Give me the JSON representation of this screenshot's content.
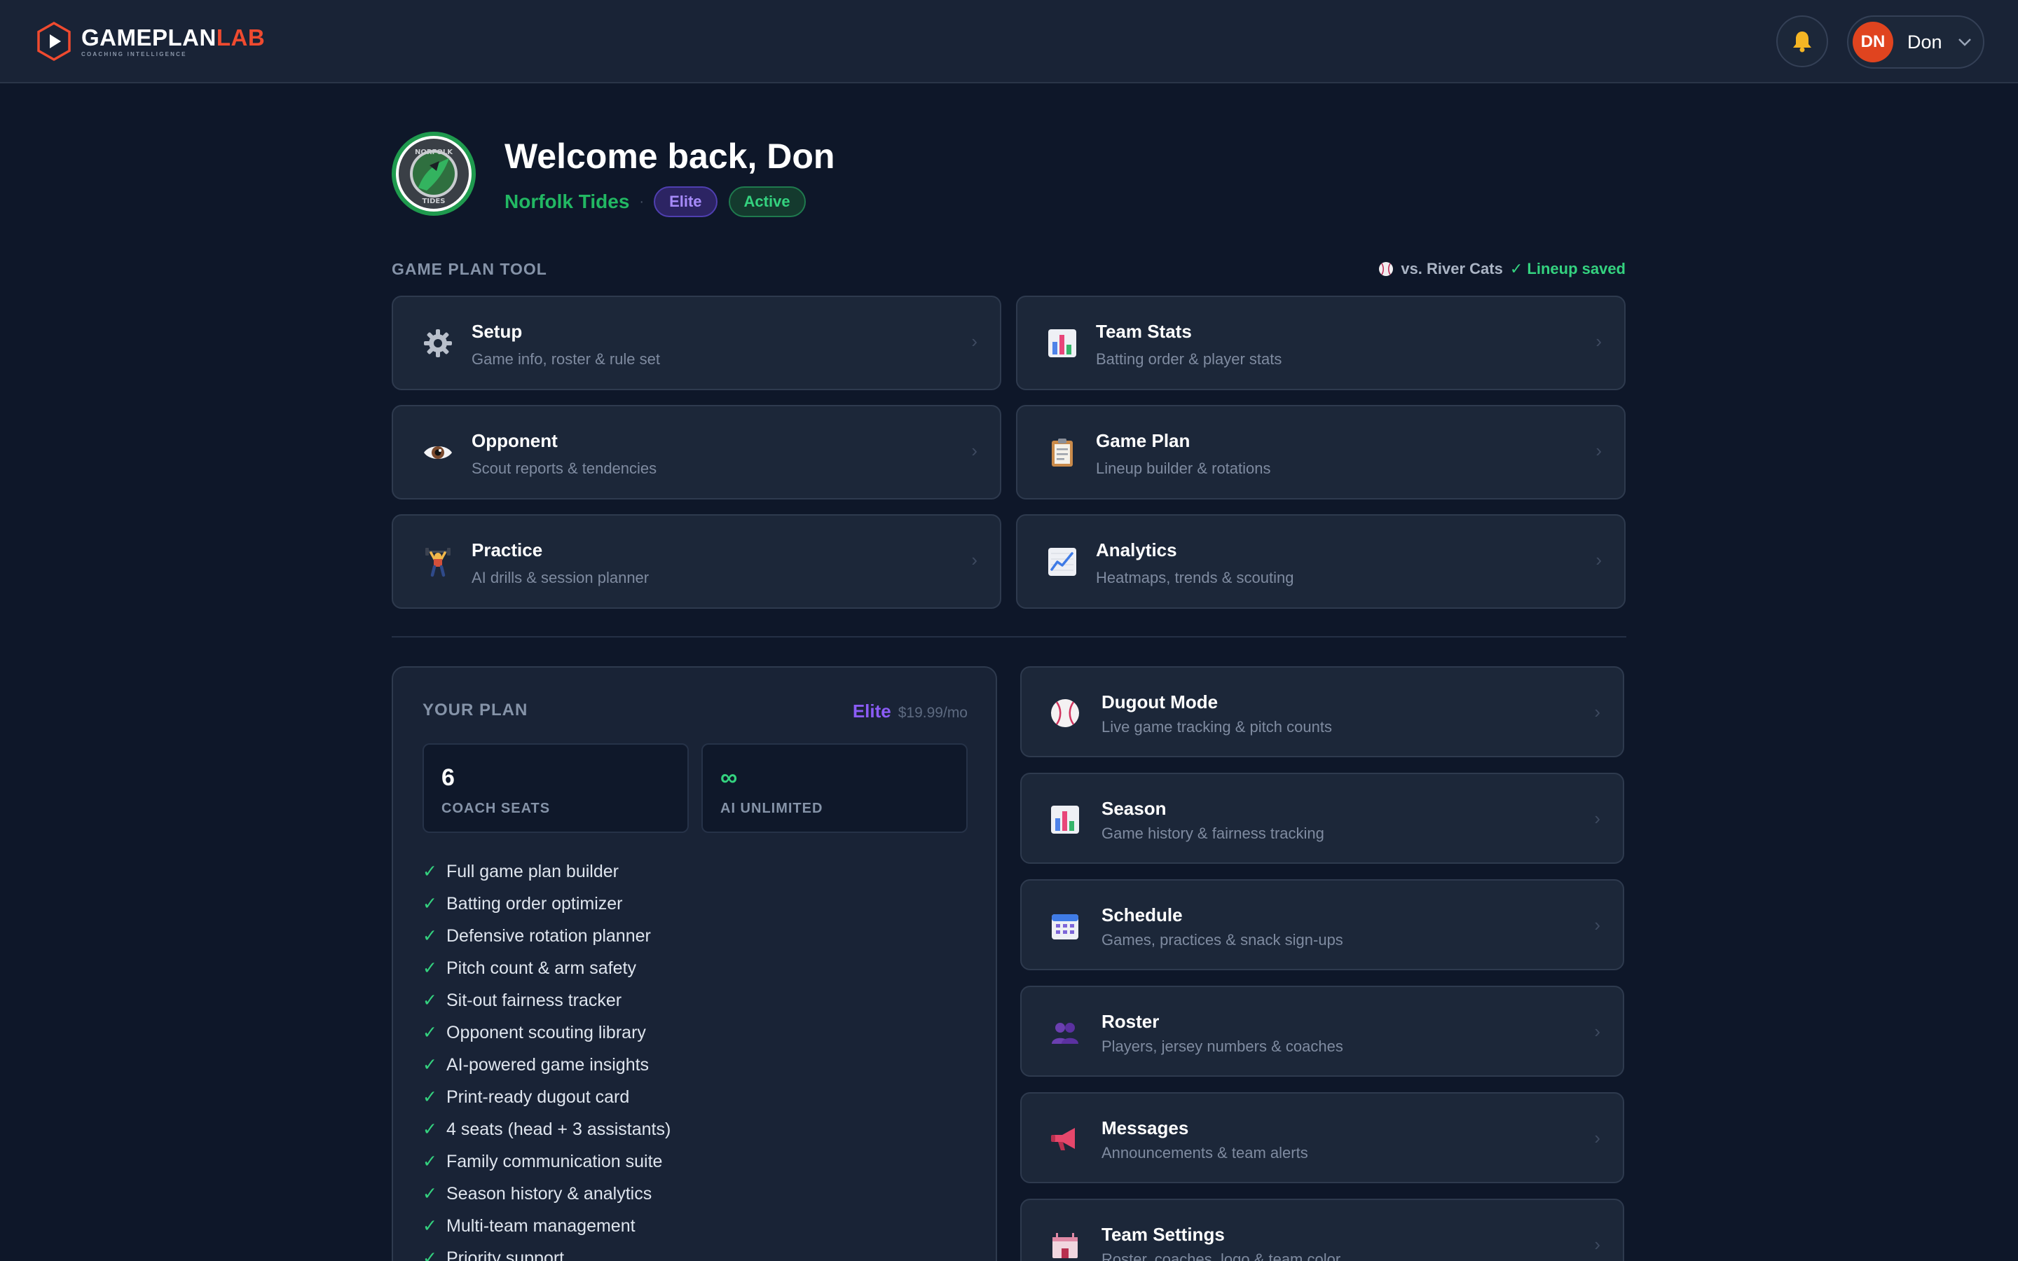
{
  "brand": {
    "name_part1": "GAMEPLAN",
    "name_part2": "LAB",
    "tagline": "COACHING INTELLIGENCE"
  },
  "user": {
    "initials": "DN",
    "name": "Don"
  },
  "header": {
    "welcome": "Welcome back, Don",
    "team_name": "Norfolk Tides",
    "separator": "·",
    "tier_badge": "Elite",
    "status_badge": "Active",
    "team_logo_text": "NORFOLK TIDES"
  },
  "game_plan_tool": {
    "label": "GAME PLAN TOOL",
    "opponent": "vs. River Cats",
    "lineup_status": "✓ Lineup saved",
    "cards": [
      {
        "title": "Setup",
        "subtitle": "Game info, roster & rule set",
        "icon": "gear-icon"
      },
      {
        "title": "Team Stats",
        "subtitle": "Batting order & player stats",
        "icon": "bar-chart-icon"
      },
      {
        "title": "Opponent",
        "subtitle": "Scout reports & tendencies",
        "icon": "eye-icon"
      },
      {
        "title": "Game Plan",
        "subtitle": "Lineup builder & rotations",
        "icon": "clipboard-icon"
      },
      {
        "title": "Practice",
        "subtitle": "AI drills & session planner",
        "icon": "weightlifter-icon"
      },
      {
        "title": "Analytics",
        "subtitle": "Heatmaps, trends & scouting",
        "icon": "trend-chart-icon"
      }
    ],
    "chevron": "›"
  },
  "plan": {
    "label": "YOUR PLAN",
    "tier": "Elite",
    "price": "$19.99/mo",
    "stats": [
      {
        "value": "6",
        "label": "COACH SEATS"
      },
      {
        "value": "∞",
        "label": "AI UNLIMITED"
      }
    ],
    "check": "✓",
    "features": [
      "Full game plan builder",
      "Batting order optimizer",
      "Defensive rotation planner",
      "Pitch count & arm safety",
      "Sit-out fairness tracker",
      "Opponent scouting library",
      "AI-powered game insights",
      "Print-ready dugout card",
      "4 seats (head + 3 assistants)",
      "Family communication suite",
      "Season history & analytics",
      "Multi-team management",
      "Priority support"
    ]
  },
  "side_cards": [
    {
      "title": "Dugout Mode",
      "subtitle": "Live game tracking & pitch counts",
      "icon": "baseball-icon"
    },
    {
      "title": "Season",
      "subtitle": "Game history & fairness tracking",
      "icon": "bar-chart-icon"
    },
    {
      "title": "Schedule",
      "subtitle": "Games, practices & snack sign-ups",
      "icon": "calendar-icon"
    },
    {
      "title": "Roster",
      "subtitle": "Players, jersey numbers & coaches",
      "icon": "people-icon"
    },
    {
      "title": "Messages",
      "subtitle": "Announcements & team alerts",
      "icon": "megaphone-icon"
    },
    {
      "title": "Team Settings",
      "subtitle": "Roster, coaches, logo & team color",
      "icon": "stadium-icon"
    }
  ],
  "colors": {
    "background": "#0e1729",
    "brand_orange": "#ef4a2f",
    "team_green": "#22b863",
    "elite_purple": "#8b5cf6",
    "success_green": "#34d27f"
  }
}
